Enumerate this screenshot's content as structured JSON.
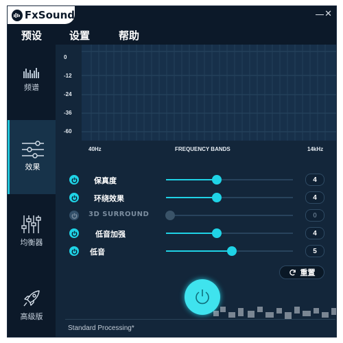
{
  "app": {
    "logo_text": "FxSound"
  },
  "window_controls": {
    "minimize": "—",
    "close": "✕"
  },
  "menu": {
    "presets": "预设",
    "settings": "设置",
    "help": "帮助"
  },
  "sidebar": {
    "items": [
      {
        "label": "频谱",
        "icon": "spectrum-icon"
      },
      {
        "label": "效果",
        "icon": "effects-sliders-icon",
        "active": true
      },
      {
        "label": "均衡器",
        "icon": "equalizer-icon"
      },
      {
        "label": "高级版",
        "icon": "rocket-icon"
      }
    ]
  },
  "spectrum": {
    "y_ticks": [
      "0",
      "-12",
      "-24",
      "-36",
      "-60"
    ],
    "x_label_low": "40Hz",
    "x_label_mid": "FREQUENCY BANDS",
    "x_label_high": "14kHz"
  },
  "effects": [
    {
      "label": "保真度",
      "value": "4",
      "level": 0.4,
      "enabled": true
    },
    {
      "label": "环绕效果",
      "value": "4",
      "level": 0.4,
      "enabled": true
    },
    {
      "label": "3D SURROUND",
      "value": "0",
      "level": 0.0,
      "enabled": false
    },
    {
      "label": "低音加强",
      "value": "4",
      "level": 0.4,
      "enabled": true
    },
    {
      "label": "低音",
      "value": "5",
      "level": 0.52,
      "enabled": true
    }
  ],
  "reset": {
    "label": "重置"
  },
  "status": {
    "text": "Standard Processing*"
  },
  "colors": {
    "accent": "#1fd3e6",
    "background": "#13263a",
    "sidebar": "#0c1929"
  }
}
